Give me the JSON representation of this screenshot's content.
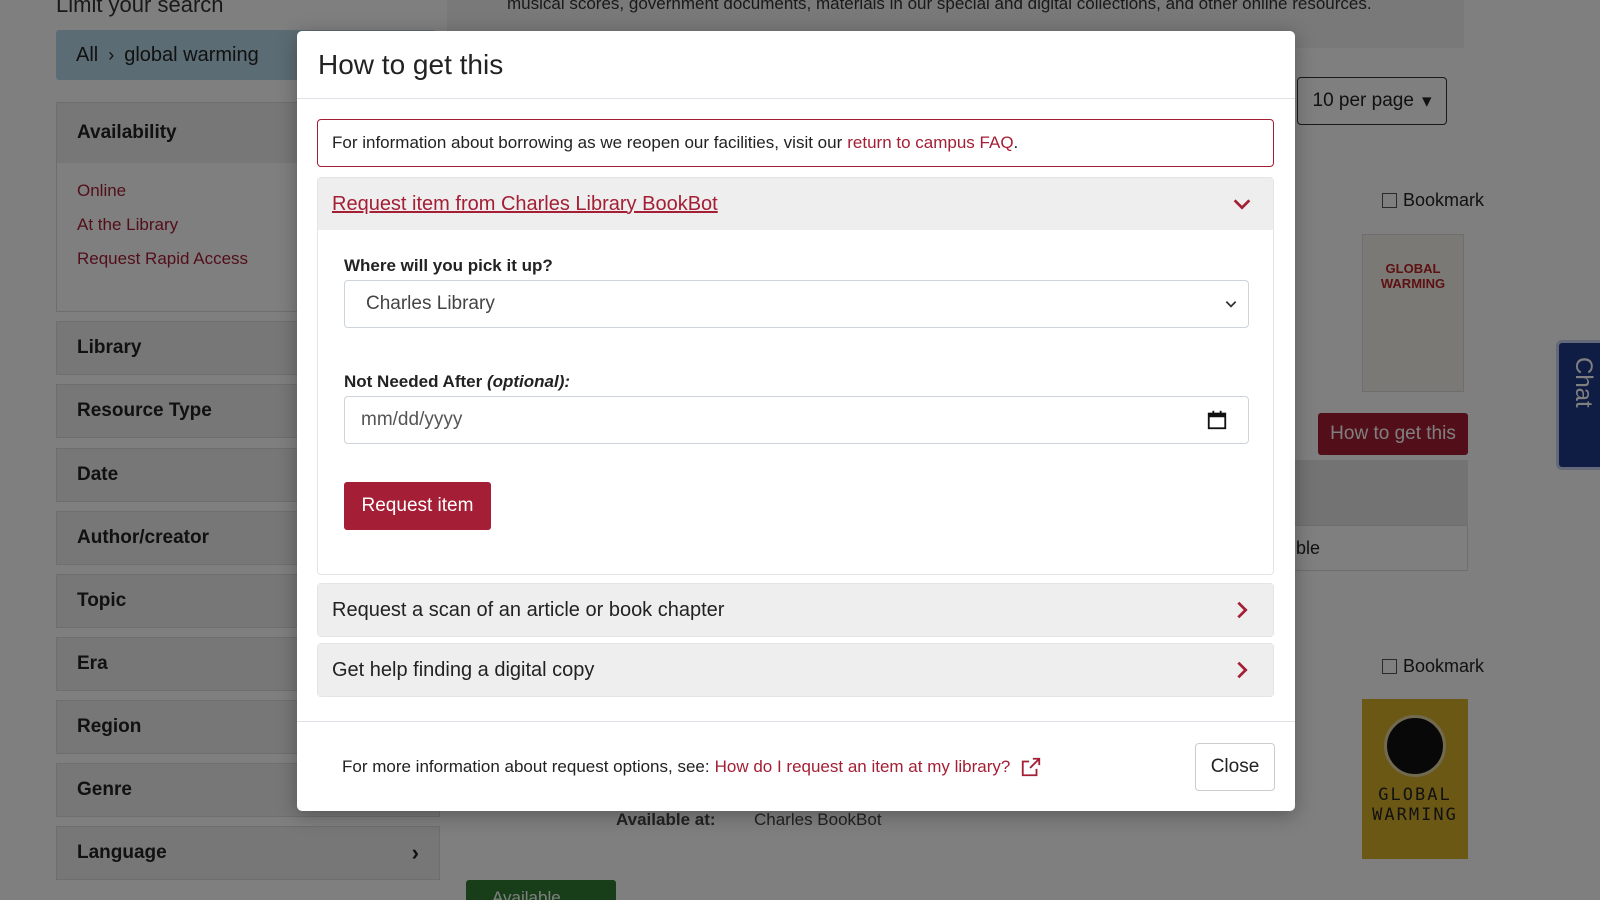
{
  "background": {
    "sidebar_title": "Limit your search",
    "breadcrumb": {
      "all": "All",
      "query": "global warming"
    },
    "availability": {
      "label": "Availability",
      "options": [
        "Online",
        "At the Library",
        "Request Rapid Access"
      ]
    },
    "facets": [
      "Library",
      "Resource Type",
      "Date",
      "Author/creator",
      "Topic",
      "Era",
      "Region",
      "Genre",
      "Language"
    ],
    "top_text": "musical scores, government documents, materials in our special and digital collections, and other online resources.",
    "per_page": "10 per page",
    "bookmark_label": "Bookmark",
    "how_to_get_button": "How to get this",
    "available_partial": "ble",
    "available_at_label": "Available at:",
    "available_at_value": "Charles BookBot",
    "available_button": "Available",
    "chat_tab": "Chat",
    "cover1_text": "GLOBAL WARMING",
    "cover2_text": "GLOBAL WARMING"
  },
  "modal": {
    "title": "How to get this",
    "notice_text": "For information about borrowing as we reopen our facilities, visit our",
    "notice_link": "return to campus FAQ",
    "notice_end": ".",
    "accordion": [
      {
        "label": "Request item from Charles Library BookBot",
        "pickup_label": "Where will you pick it up?",
        "pickup_value": "Charles Library",
        "date_label": "Not Needed After",
        "date_optional": "(optional):",
        "date_placeholder": "mm/dd/yyyy",
        "submit_label": "Request item"
      },
      {
        "label": "Request a scan of an article or book chapter"
      },
      {
        "label": "Get help finding a digital copy"
      }
    ],
    "footer_text": "For more information about request options, see:",
    "footer_link": "How do I request an item at my library?",
    "close_label": "Close"
  },
  "colors": {
    "brand": "#a41e35",
    "accent_blue": "#b7d8e8"
  }
}
